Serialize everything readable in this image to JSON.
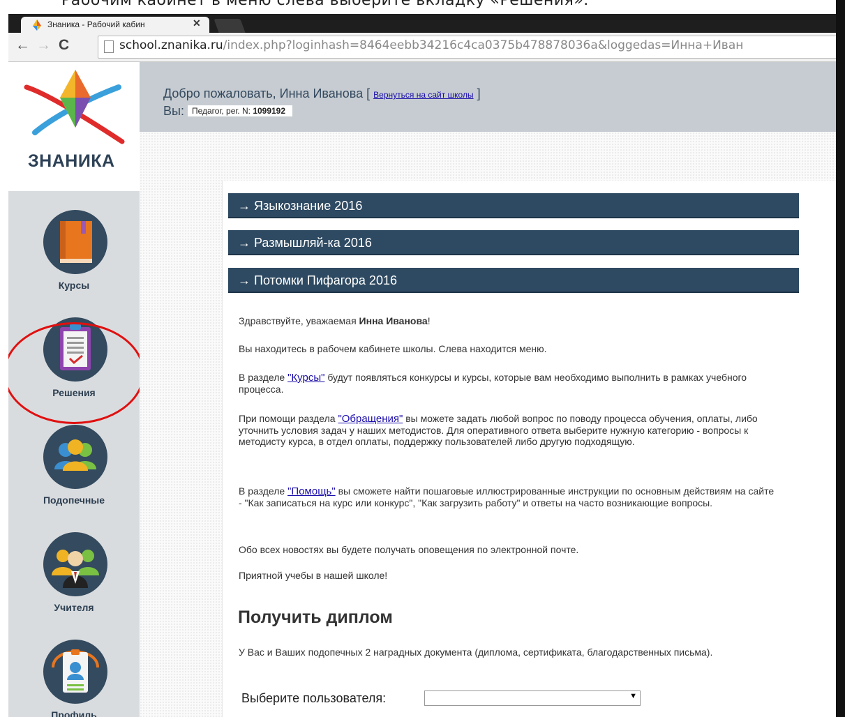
{
  "caption": {
    "text": "Рабочим кабинет в меню слева выберите вкладку «Решения»."
  },
  "browser": {
    "tab_title": "Знаника - Рабочий кабин",
    "tab_close": "✕",
    "url_host": "school.znanika.ru",
    "url_path": "/index.php?loginhash=8464eebb34216c4ca0375b478878036a&loggedas=Инна+Иван"
  },
  "site": {
    "logo_text": "ЗНАНИКА",
    "header": {
      "welcome_text": "Добро пожаловать, Инна Иванова",
      "back_link": "Вернуться на сайт школы",
      "role_label": "Вы:",
      "role_value": "Педагог, рег. N: ",
      "reg_number": "1099192"
    },
    "sidebar": {
      "items": [
        {
          "label": "Курсы"
        },
        {
          "label": "Решения"
        },
        {
          "label": "Подопечные"
        },
        {
          "label": "Учителя"
        },
        {
          "label": "Профиль"
        }
      ]
    },
    "courses": [
      {
        "label": "→  Языкознание 2016"
      },
      {
        "label": "→  Размышляй-ка 2016"
      },
      {
        "label": "→  Потомки Пифагора 2016"
      }
    ],
    "greeting": {
      "prefix": "Здравствуйте, уважаемая ",
      "name": "Инна Иванова",
      "suffix": "!"
    },
    "intro": "Вы находитесь в рабочем кабинете школы. Слева находится меню.",
    "courses_par": {
      "prefix": "В разделе ",
      "link": "\"Курсы\"",
      "suffix": " будут появляться конкурсы и курсы, которые вам необходимо выполнить в рамках учебного процесса."
    },
    "appeals_par": {
      "prefix": "При помощи раздела ",
      "link": "\"Обращения\"",
      "suffix": " вы можете задать любой вопрос по поводу процесса обучения, оплаты, либо уточнить условия задач у наших методистов. Для оперативного ответа выберите нужную категорию - вопросы к методисту курса, в отдел оплаты, поддержку пользователей либо другую подходящую."
    },
    "help_par": {
      "prefix": "В разделе ",
      "link": "\"Помощь\"",
      "suffix": " вы сможете найти пошаговые иллюстрированные инструкции по основным действиям на сайте - \"Как записаться на курс или конкурс\", \"Как загрузить работу\" и ответы на часто возникающие вопросы."
    },
    "news_par": "Обо всех новостях вы будете получать оповещения по электронной почте.",
    "closing": "Приятной учебы в нашей школе!",
    "diploma": {
      "title": "Получить диплом",
      "text": "У Вас и Ваших подопечных 2 наградных документа (диплома, сертификата, благодарственных письма).",
      "select_label": "Выберите пользователя:",
      "select_value": "",
      "select_arrow": "▼"
    }
  },
  "colors": {
    "nav_circle": "#344a5e",
    "course_bar": "#2e4a62",
    "highlight": "#e01010",
    "sidebar_bg": "#d9dcdf"
  }
}
